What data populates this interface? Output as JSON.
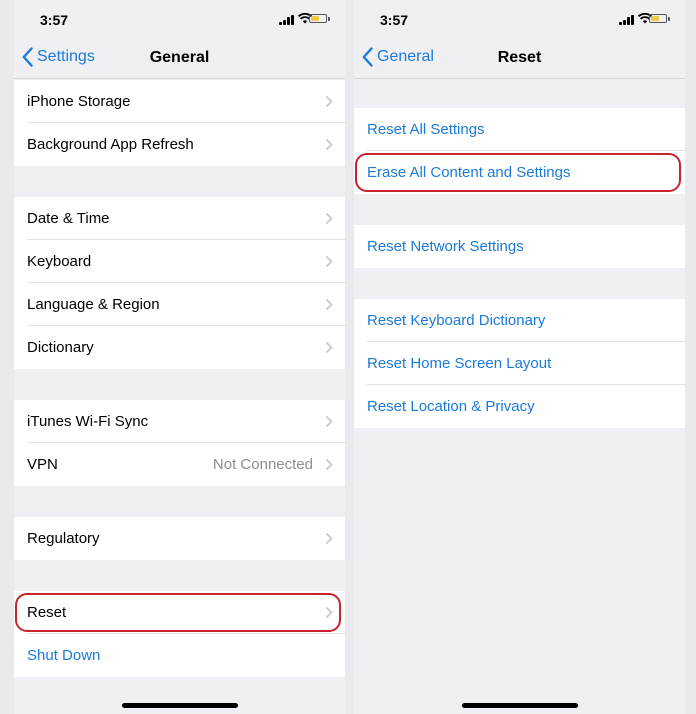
{
  "left": {
    "status": {
      "time": "3:57"
    },
    "nav": {
      "back_label": "Settings",
      "title": "General"
    },
    "rows": {
      "iphone_storage": "iPhone Storage",
      "background_refresh": "Background App Refresh",
      "date_time": "Date & Time",
      "keyboard": "Keyboard",
      "language_region": "Language & Region",
      "dictionary": "Dictionary",
      "itunes_sync": "iTunes Wi-Fi Sync",
      "vpn": "VPN",
      "vpn_status": "Not Connected",
      "regulatory": "Regulatory",
      "reset": "Reset",
      "shut_down": "Shut Down"
    }
  },
  "right": {
    "status": {
      "time": "3:57"
    },
    "nav": {
      "back_label": "General",
      "title": "Reset"
    },
    "rows": {
      "reset_all": "Reset All Settings",
      "erase_all": "Erase All Content and Settings",
      "reset_network": "Reset Network Settings",
      "reset_keyboard": "Reset Keyboard Dictionary",
      "reset_home": "Reset Home Screen Layout",
      "reset_location": "Reset Location & Privacy"
    }
  },
  "colors": {
    "accent": "#1a7bd8",
    "highlight": "#c9242b",
    "battery": "#f2c84b",
    "background": "#efeff4"
  }
}
